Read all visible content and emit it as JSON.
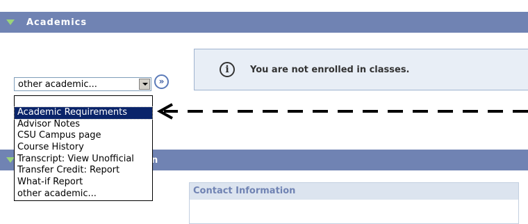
{
  "academics_section": {
    "title": "Academics"
  },
  "section2": {
    "title_fragment": "n"
  },
  "notice": {
    "icon": "info-icon",
    "message": "You are not enrolled in classes."
  },
  "select": {
    "value": "other academic...",
    "go_glyph": "»"
  },
  "dropdown": {
    "options": [
      "Academic Requirements",
      "Advisor Notes",
      "CSU Campus page",
      "Course History",
      "Transcript: View Unofficial",
      "Transfer Credit: Report",
      "What-if Report",
      "other academic..."
    ],
    "selected_index": 0
  },
  "contact": {
    "header": "Contact Information"
  },
  "colors": {
    "section_bar": "#7083b3",
    "selected_option": "#0a246a",
    "notice_bg": "#e8eef6"
  }
}
